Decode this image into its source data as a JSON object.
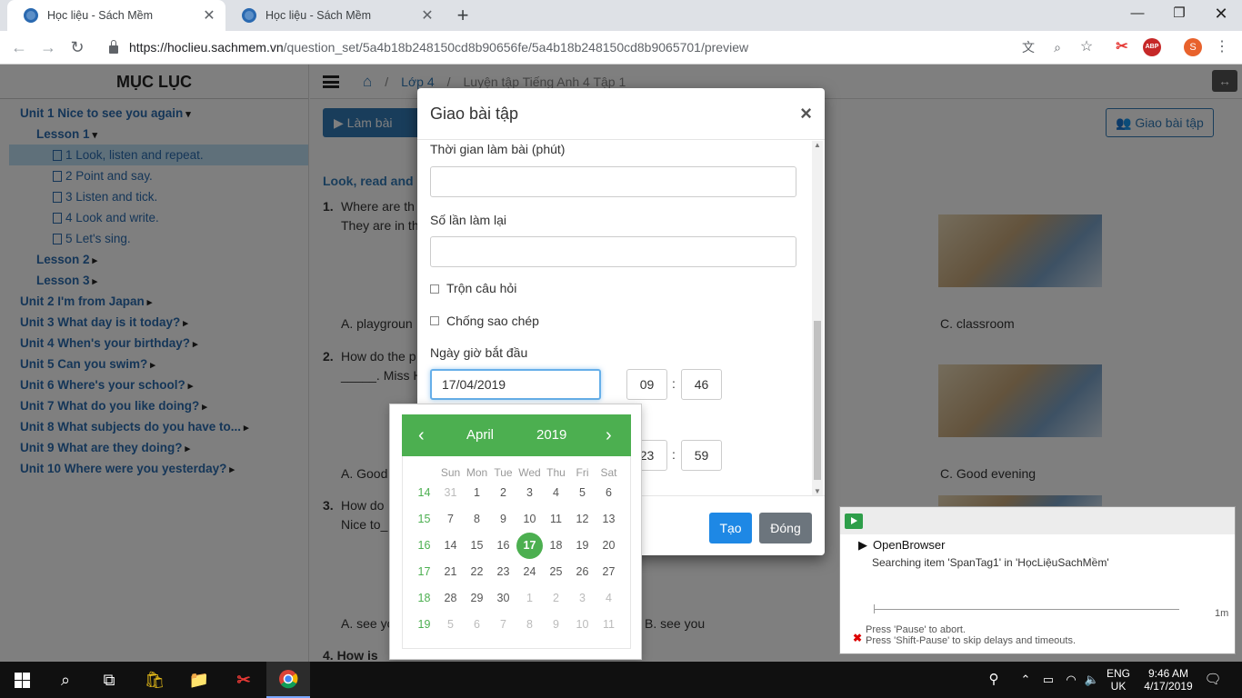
{
  "browser": {
    "tabs": [
      {
        "title": "Học liệu - Sách Mềm",
        "active": true
      },
      {
        "title": "Học liệu - Sách Mềm",
        "active": false
      }
    ],
    "url_host": "https://hoclieu.sachmem.vn",
    "url_path": "/question_set/5a4b18b248150cd8b90656fe/5a4b18b248150cd8b9065701/preview",
    "profile_initial": "S",
    "abp_label": "ABP"
  },
  "sidebar": {
    "title": "MỤC LỤC",
    "items": [
      {
        "label": "Unit 1 Nice to see you again",
        "level": "unit",
        "caret": "▾"
      },
      {
        "label": "Lesson 1",
        "level": "lesson",
        "caret": "▾"
      },
      {
        "label": "1 Look, listen and repeat.",
        "level": "item",
        "selected": true
      },
      {
        "label": "2 Point and say.",
        "level": "item"
      },
      {
        "label": "3 Listen and tick.",
        "level": "item"
      },
      {
        "label": "4 Look and write.",
        "level": "item"
      },
      {
        "label": "5 Let's sing.",
        "level": "item"
      },
      {
        "label": "Lesson 2",
        "level": "lesson",
        "caret": "▸"
      },
      {
        "label": "Lesson 3",
        "level": "lesson",
        "caret": "▸"
      },
      {
        "label": "Unit 2 I'm from Japan",
        "level": "unit",
        "caret": "▸"
      },
      {
        "label": "Unit 3 What day is it today?",
        "level": "unit",
        "caret": "▸"
      },
      {
        "label": "Unit 4 When's your birthday?",
        "level": "unit",
        "caret": "▸"
      },
      {
        "label": "Unit 5 Can you swim?",
        "level": "unit",
        "caret": "▸"
      },
      {
        "label": "Unit 6 Where's your school?",
        "level": "unit",
        "caret": "▸"
      },
      {
        "label": "Unit 7 What do you like doing?",
        "level": "unit",
        "caret": "▸"
      },
      {
        "label": "Unit 8 What subjects do you have to...",
        "level": "unit",
        "caret": "▸"
      },
      {
        "label": "Unit 9 What are they doing?",
        "level": "unit",
        "caret": "▸"
      },
      {
        "label": "Unit 10 Where were you yesterday?",
        "level": "unit",
        "caret": "▸"
      }
    ]
  },
  "main": {
    "breadcrumb": [
      "Lớp 4",
      "Luyện tập Tiếng Anh 4 Tập 1"
    ],
    "lam_bai_label": "▶ Làm bài",
    "giao_bai_tap_label": "Giao bài tập",
    "section_title": "Look, read and",
    "q1_num": "1.",
    "q1_line1": "Where are th",
    "q1_line2": "They are in th",
    "q1_a": "A. playgroun",
    "q1_c": "C. classroom",
    "q2_num": "2.",
    "q2_line1": "How do the p",
    "q2_line2": "_____. Miss Hi",
    "q2_a": "A. Good",
    "q2_c": "C. Good evening",
    "q3_num": "3.",
    "q3_line1": "How do",
    "q3_line2": "Nice to_",
    "q3_a": "A. see yo",
    "q3_b": "B. see you",
    "q4": "4. How is"
  },
  "modal": {
    "title": "Giao bài tập",
    "close": "×",
    "duration_label": "Thời gian làm bài (phút)",
    "duration_value": "",
    "retries_label": "Số lần làm lại",
    "retries_value": "",
    "shuffle_label": "Trộn câu hỏi",
    "anticopy_label": "Chống sao chép",
    "start_label": "Ngày giờ bắt đầu",
    "start_date": "17/04/2019",
    "start_hour": "09",
    "start_minute": "46",
    "end_hour": "23",
    "end_minute": "59",
    "create_label": "Tạo",
    "close_label": "Đóng"
  },
  "datepicker": {
    "prev": "‹",
    "next": "›",
    "month": "April",
    "year": "2019",
    "dow": [
      "Sun",
      "Mon",
      "Tue",
      "Wed",
      "Thu",
      "Fri",
      "Sat"
    ],
    "selected_day": 17,
    "rows": [
      {
        "week": "14",
        "days": [
          [
            "31",
            1
          ],
          [
            "1",
            0
          ],
          [
            "2",
            0
          ],
          [
            "3",
            0
          ],
          [
            "4",
            0
          ],
          [
            "5",
            0
          ],
          [
            "6",
            0
          ]
        ]
      },
      {
        "week": "15",
        "days": [
          [
            "7",
            0
          ],
          [
            "8",
            0
          ],
          [
            "9",
            0
          ],
          [
            "10",
            0
          ],
          [
            "11",
            0
          ],
          [
            "12",
            0
          ],
          [
            "13",
            0
          ]
        ]
      },
      {
        "week": "16",
        "days": [
          [
            "14",
            0
          ],
          [
            "15",
            0
          ],
          [
            "16",
            0
          ],
          [
            "17",
            0
          ],
          [
            "18",
            0
          ],
          [
            "19",
            0
          ],
          [
            "20",
            0
          ]
        ]
      },
      {
        "week": "17",
        "days": [
          [
            "21",
            0
          ],
          [
            "22",
            0
          ],
          [
            "23",
            0
          ],
          [
            "24",
            0
          ],
          [
            "25",
            0
          ],
          [
            "26",
            0
          ],
          [
            "27",
            0
          ]
        ]
      },
      {
        "week": "18",
        "days": [
          [
            "28",
            0
          ],
          [
            "29",
            0
          ],
          [
            "30",
            0
          ],
          [
            "1",
            1
          ],
          [
            "2",
            1
          ],
          [
            "3",
            1
          ],
          [
            "4",
            1
          ]
        ]
      },
      {
        "week": "19",
        "days": [
          [
            "5",
            1
          ],
          [
            "6",
            1
          ],
          [
            "7",
            1
          ],
          [
            "8",
            1
          ],
          [
            "9",
            1
          ],
          [
            "10",
            1
          ],
          [
            "11",
            1
          ]
        ]
      }
    ]
  },
  "notification": {
    "action": "OpenBrowser",
    "detail": "Searching item 'SpanTag1' in 'HọcLiệuSachMềm'",
    "duration": "1m",
    "hint1": "Press 'Pause' to abort.",
    "hint2": "Press 'Shift-Pause' to skip delays and timeouts."
  },
  "taskbar": {
    "lang_top": "ENG",
    "lang_bottom": "UK",
    "time": "9:46 AM",
    "date": "4/17/2019"
  }
}
